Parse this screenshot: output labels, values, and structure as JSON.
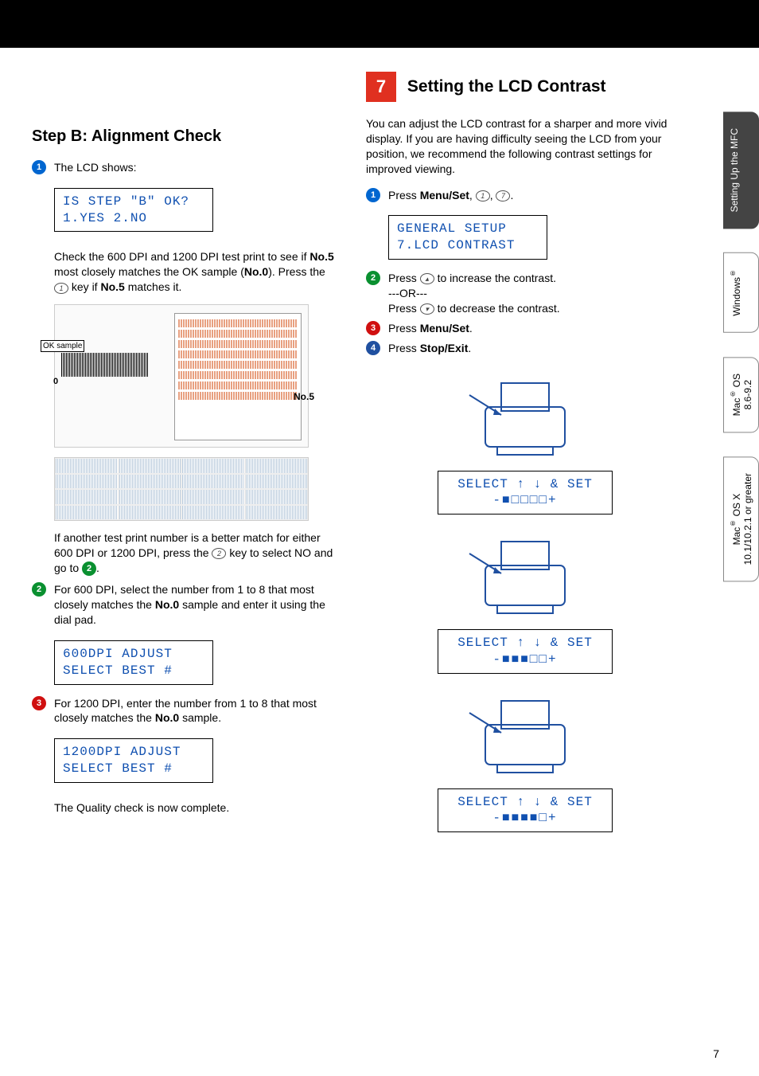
{
  "left": {
    "title": "Step B:  Alignment Check",
    "step1_intro": "The LCD shows:",
    "lcd1_line1": "IS STEP \"B\" OK?",
    "lcd1_line2": "1.YES 2.NO",
    "para1_a": "Check the 600 DPI and 1200 DPI test print to see if ",
    "para1_b": "No.5",
    "para1_c": " most closely matches the OK sample (",
    "para1_d": "No.0",
    "para1_e": "). Press the ",
    "para1_key": "1",
    "para1_f": " key if ",
    "para1_g": "No.5",
    "para1_h": " matches it.",
    "fig_ok": "OK sample",
    "fig_no5": "No.5",
    "para2_a": "If another test print number is a better match for either 600 DPI or 1200 DPI, press the ",
    "para2_key": "2",
    "para2_b": " key to select NO and go to ",
    "para2_bullet": "2",
    "para2_c": ".",
    "step2_a": "For 600 DPI, select the number from 1 to 8 that most closely matches the ",
    "step2_b": "No.0",
    "step2_c": " sample and enter it using the dial pad.",
    "lcd2_line1": "600DPI ADJUST",
    "lcd2_line2": "SELECT BEST #",
    "step3_a": "For 1200 DPI, enter the number from 1 to 8 that most closely matches the ",
    "step3_b": "No.0",
    "step3_c": " sample.",
    "lcd3_line1": "1200DPI ADJUST",
    "lcd3_line2": "SELECT BEST #",
    "final": "The Quality check is now complete."
  },
  "right": {
    "box_num": "7",
    "title": "Setting the LCD Contrast",
    "intro": "You can adjust the LCD contrast for a sharper and more vivid display. If you are having difficulty seeing the LCD from your position, we recommend the following contrast settings for improved viewing.",
    "s1_a": "Press ",
    "s1_b": "Menu/Set",
    "s1_c": ", ",
    "s1_key1": "1",
    "s1_d": ", ",
    "s1_key2": "7",
    "s1_e": ".",
    "lcd1_line1": "GENERAL SETUP",
    "lcd1_line2": "7.LCD CONTRAST",
    "s2_a": "Press ",
    "s2_b": " to increase the contrast.",
    "s2_or": "---OR---",
    "s2_c": "Press ",
    "s2_d": " to decrease the contrast.",
    "s3_a": "Press ",
    "s3_b": "Menu/Set",
    "s3_c": ".",
    "s4_a": "Press ",
    "s4_b": "Stop/Exit",
    "s4_c": ".",
    "lcd_sel": "SELECT ↑ ↓ & SET",
    "bar1": "-■□□□□+",
    "bar2": "-■■■□□+",
    "bar3": "-■■■■□+"
  },
  "tabs": {
    "t1": "Setting Up the MFC",
    "t2": "Windows®",
    "t3": "Mac® OS 8.6-9.2",
    "t4": "Mac® OS X 10.1/10.2.1 or greater"
  },
  "page": "7"
}
